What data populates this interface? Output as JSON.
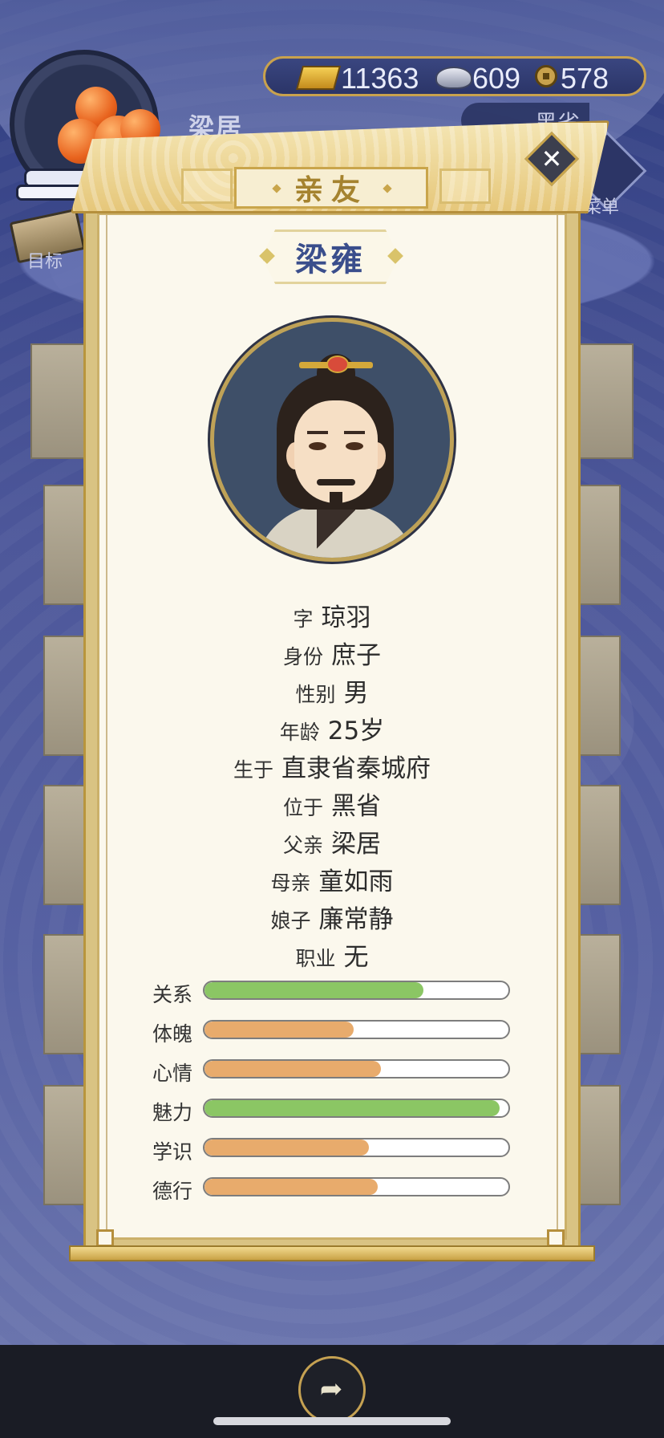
{
  "hud": {
    "player_name": "梁居",
    "gold": "11363",
    "silver": "609",
    "coins": "578",
    "location": "黑省",
    "menu_label": "菜单",
    "goal_label": "目标"
  },
  "dialog": {
    "title": "亲友",
    "close_icon": "close-icon",
    "character_name": "梁雍"
  },
  "profile": [
    {
      "key": "字",
      "value": "琼羽"
    },
    {
      "key": "身份",
      "value": "庶子"
    },
    {
      "key": "性别",
      "value": "男"
    },
    {
      "key": "年龄",
      "value": "25岁"
    },
    {
      "key": "生于",
      "value": "直隶省秦城府"
    },
    {
      "key": "位于",
      "value": "黑省"
    },
    {
      "key": "父亲",
      "value": "梁居"
    },
    {
      "key": "母亲",
      "value": "童如雨"
    },
    {
      "key": "娘子",
      "value": "廉常静"
    },
    {
      "key": "职业",
      "value": "无"
    }
  ],
  "stats": [
    {
      "label": "关系",
      "fraction": 0.72,
      "color": "#8bc664"
    },
    {
      "label": "体魄",
      "fraction": 0.49,
      "color": "#e8ab6c"
    },
    {
      "label": "心情",
      "fraction": 0.58,
      "color": "#e8ab6c"
    },
    {
      "label": "魅力",
      "fraction": 0.97,
      "color": "#8bc664"
    },
    {
      "label": "学识",
      "fraction": 0.54,
      "color": "#e8ab6c"
    },
    {
      "label": "德行",
      "fraction": 0.57,
      "color": "#e8ab6c"
    }
  ],
  "footer": {
    "share_icon": "share-icon"
  }
}
